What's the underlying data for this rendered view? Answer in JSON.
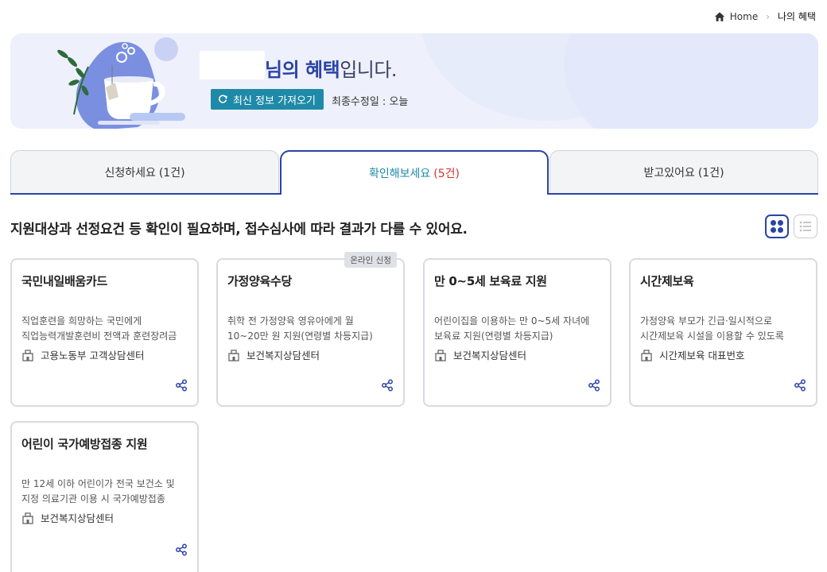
{
  "breadcrumb": {
    "home": "Home",
    "current": "나의 혜택"
  },
  "banner": {
    "greeting_suffix": "님의 ",
    "greeting_highlight": "혜택",
    "greeting_end": "입니다.",
    "refresh_label": "최신 정보 가져오기",
    "updated_text": "최종수정일 : 오늘"
  },
  "tabs": [
    {
      "label": "신청하세요",
      "count": "(1건)"
    },
    {
      "label": "확인해보세요",
      "count": "(5건)"
    },
    {
      "label": "받고있어요",
      "count": "(1건)"
    }
  ],
  "subtitle": "지원대상과 선정요건 등 확인이 필요하며, 접수심사에 따라 결과가 다를 수 있어요.",
  "cards": [
    {
      "title": "국민내일배움카드",
      "desc1": "직업훈련을 희망하는 국민에게",
      "desc2": "직업능력개발훈련비 전액과 훈련장려금",
      "agency": "고용노동부 고객상담센터",
      "tag": ""
    },
    {
      "title": "가정양육수당",
      "desc1": "취학 전 가정양육 영유아에게 월",
      "desc2": "10~20만 원 지원(연령별 차등지급)",
      "agency": "보건복지상담센터",
      "tag": "온라인 신청"
    },
    {
      "title": "만 0~5세 보육료 지원",
      "desc1": "어린이집을 이용하는 만 0~5세 자녀에",
      "desc2": "보육료 지원(연령별 차등지급)",
      "agency": "보건복지상담센터",
      "tag": ""
    },
    {
      "title": "시간제보육",
      "desc1": "가정양육 부모가 긴급·일시적으로",
      "desc2": "시간제보육 시설을 이용할 수 있도록",
      "agency": "시간제보육 대표번호",
      "tag": ""
    },
    {
      "title": "어린이 국가예방접종 지원",
      "desc1": "만 12세 이하 어린이가 전국 보건소 및",
      "desc2": "지정 의료기관 이용 시 국가예방접종",
      "agency": "보건복지상담센터",
      "tag": ""
    }
  ],
  "colors": {
    "accent": "#2b43a6",
    "teal": "#1e8aa8",
    "count_red": "#d63232"
  },
  "icons": {
    "home": "home-icon",
    "refresh": "refresh-icon",
    "agency": "building-icon",
    "share": "share-icon",
    "grid_view": "grid-view-icon",
    "list_view": "list-view-icon"
  }
}
